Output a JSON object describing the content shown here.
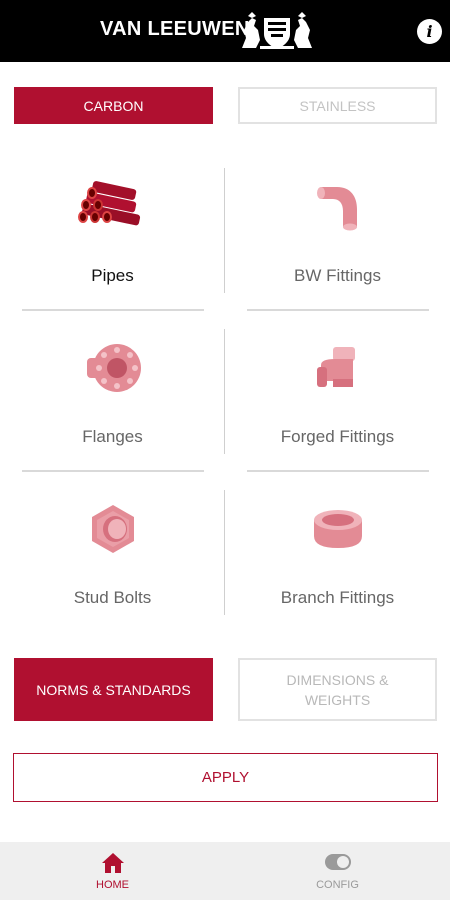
{
  "header": {
    "brand": "VAN LEEUWEN",
    "logo_icon": "lion-crest-logo",
    "info_icon": "info-icon",
    "info_glyph": "i"
  },
  "material_toggle": {
    "options": [
      "CARBON",
      "STAINLESS"
    ],
    "selected": "CARBON"
  },
  "products": [
    {
      "label": "Pipes",
      "icon": "pipes-icon",
      "selected": true
    },
    {
      "label": "BW Fittings",
      "icon": "bw-fitting-elbow-icon",
      "selected": false
    },
    {
      "label": "Flanges",
      "icon": "flange-icon",
      "selected": false
    },
    {
      "label": "Forged Fittings",
      "icon": "forged-elbow-icon",
      "selected": false
    },
    {
      "label": "Stud Bolts",
      "icon": "hex-nut-icon",
      "selected": false
    },
    {
      "label": "Branch Fittings",
      "icon": "branch-fitting-icon",
      "selected": false
    }
  ],
  "mode_toggle": {
    "norms_label": "NORMS & STANDARDS",
    "dimensions_label": "DIMENSIONS & WEIGHTS",
    "selected": "NORMS & STANDARDS"
  },
  "apply_label": "APPLY",
  "tabbar": {
    "home": {
      "label": "HOME",
      "icon": "home-icon",
      "active": true
    },
    "config": {
      "label": "CONFIG",
      "icon": "toggle-icon",
      "active": false
    }
  },
  "colors": {
    "accent": "#b01030",
    "header_bg": "#000000",
    "muted_icon": "#e38b95",
    "tabbar_bg": "#efefef"
  }
}
